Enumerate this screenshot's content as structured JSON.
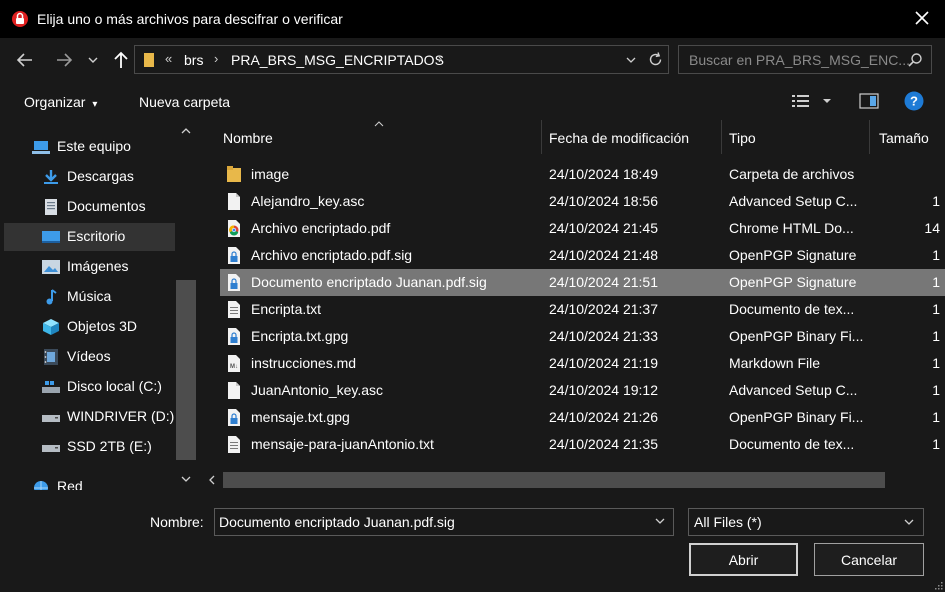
{
  "window": {
    "title": "Elija uno o más archivos para descifrar o verificar"
  },
  "nav": {
    "breadcrumb": [
      "brs",
      "PRA_BRS_MSG_ENCRIPTADOS"
    ],
    "overflow": "«",
    "search_placeholder": "Buscar en PRA_BRS_MSG_ENC..."
  },
  "toolbar": {
    "organize": "Organizar",
    "new_folder": "Nueva carpeta"
  },
  "sidebar": {
    "items": [
      {
        "label": "Este equipo",
        "icon": "computer-icon"
      },
      {
        "label": "Descargas",
        "icon": "download-icon"
      },
      {
        "label": "Documentos",
        "icon": "document-icon"
      },
      {
        "label": "Escritorio",
        "icon": "desktop-icon"
      },
      {
        "label": "Imágenes",
        "icon": "image-icon"
      },
      {
        "label": "Música",
        "icon": "music-icon"
      },
      {
        "label": "Objetos 3D",
        "icon": "cube-icon"
      },
      {
        "label": "Vídeos",
        "icon": "video-icon"
      },
      {
        "label": "Disco local (C:)",
        "icon": "drive-icon"
      },
      {
        "label": "WINDRIVER (D:)",
        "icon": "drive-icon"
      },
      {
        "label": "SSD 2TB (E:)",
        "icon": "drive-icon"
      },
      {
        "label": "Red",
        "icon": "network-icon"
      }
    ],
    "selected": "Escritorio"
  },
  "list": {
    "columns": [
      "Nombre",
      "Fecha de modificación",
      "Tipo",
      "Tamaño"
    ],
    "rows": [
      {
        "name": "image",
        "date": "24/10/2024 18:49",
        "type": "Carpeta de archivos",
        "size": "",
        "icon": "folder-icon"
      },
      {
        "name": "Alejandro_key.asc",
        "date": "24/10/2024 18:56",
        "type": "Advanced Setup C...",
        "size": "1",
        "icon": "file-icon"
      },
      {
        "name": "Archivo encriptado.pdf",
        "date": "24/10/2024 21:45",
        "type": "Chrome HTML Do...",
        "size": "14",
        "icon": "chrome-file-icon"
      },
      {
        "name": "Archivo encriptado.pdf.sig",
        "date": "24/10/2024 21:48",
        "type": "OpenPGP Signature",
        "size": "1",
        "icon": "lock-file-icon"
      },
      {
        "name": "Documento encriptado Juanan.pdf.sig",
        "date": "24/10/2024 21:51",
        "type": "OpenPGP Signature",
        "size": "1",
        "icon": "lock-file-icon"
      },
      {
        "name": "Encripta.txt",
        "date": "24/10/2024 21:37",
        "type": "Documento de tex...",
        "size": "1",
        "icon": "text-file-icon"
      },
      {
        "name": "Encripta.txt.gpg",
        "date": "24/10/2024 21:33",
        "type": "OpenPGP Binary Fi...",
        "size": "1",
        "icon": "lock-file-icon"
      },
      {
        "name": "instrucciones.md",
        "date": "24/10/2024 21:19",
        "type": "Markdown File",
        "size": "1",
        "icon": "markdown-file-icon"
      },
      {
        "name": "JuanAntonio_key.asc",
        "date": "24/10/2024 19:12",
        "type": "Advanced Setup C...",
        "size": "1",
        "icon": "file-icon"
      },
      {
        "name": "mensaje.txt.gpg",
        "date": "24/10/2024 21:26",
        "type": "OpenPGP Binary Fi...",
        "size": "1",
        "icon": "lock-file-icon"
      },
      {
        "name": "mensaje-para-juanAntonio.txt",
        "date": "24/10/2024 21:35",
        "type": "Documento de tex...",
        "size": "1",
        "icon": "text-file-icon"
      }
    ],
    "selected": "Documento encriptado Juanan.pdf.sig"
  },
  "footer": {
    "filename_label": "Nombre:",
    "filename_value": "Documento encriptado Juanan.pdf.sig",
    "filter_value": "All Files (*)",
    "open_label": "Abrir",
    "cancel_label": "Cancelar"
  },
  "colors": {
    "background": "#191919",
    "titlebar": "#000000",
    "selected_row": "#777777",
    "selected_sidebar": "#333333",
    "help_icon": "#1e7bd6",
    "folder": "#e8b84a"
  }
}
